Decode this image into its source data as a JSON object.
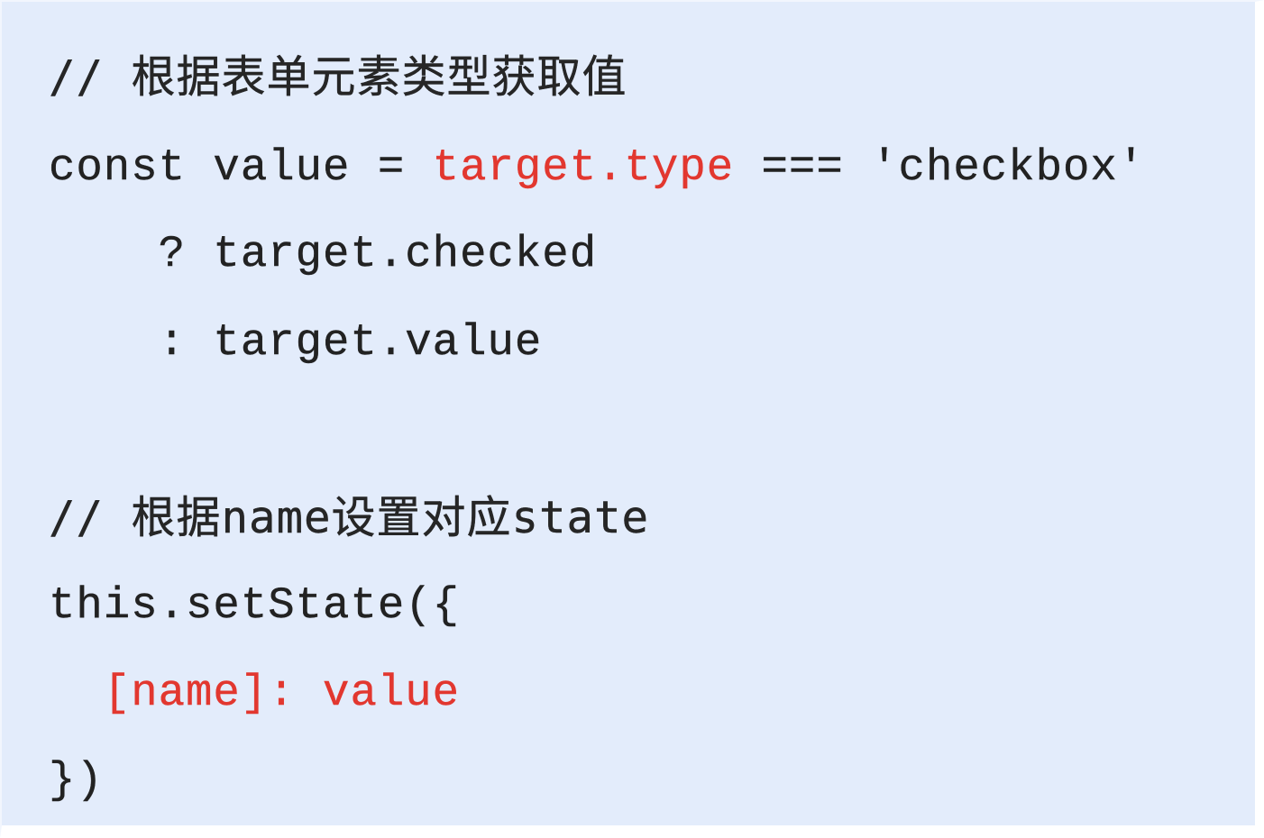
{
  "code": {
    "line1": {
      "text": "// 根据表单元素类型获取值"
    },
    "line2": {
      "part1": "const value = ",
      "part2": "target.type",
      "part3": " === 'checkbox'"
    },
    "line3": {
      "text": "    ? target.checked"
    },
    "line4": {
      "text": "    : target.value"
    },
    "line5": {
      "text": "// 根据name设置对应state"
    },
    "line6": {
      "text": "this.setState({"
    },
    "line7": {
      "indent": "  ",
      "part1": "[name]: value"
    },
    "line8": {
      "text": "})"
    }
  },
  "colors": {
    "background": "#e3ecfb",
    "text": "#222222",
    "highlight": "#e2372f"
  }
}
